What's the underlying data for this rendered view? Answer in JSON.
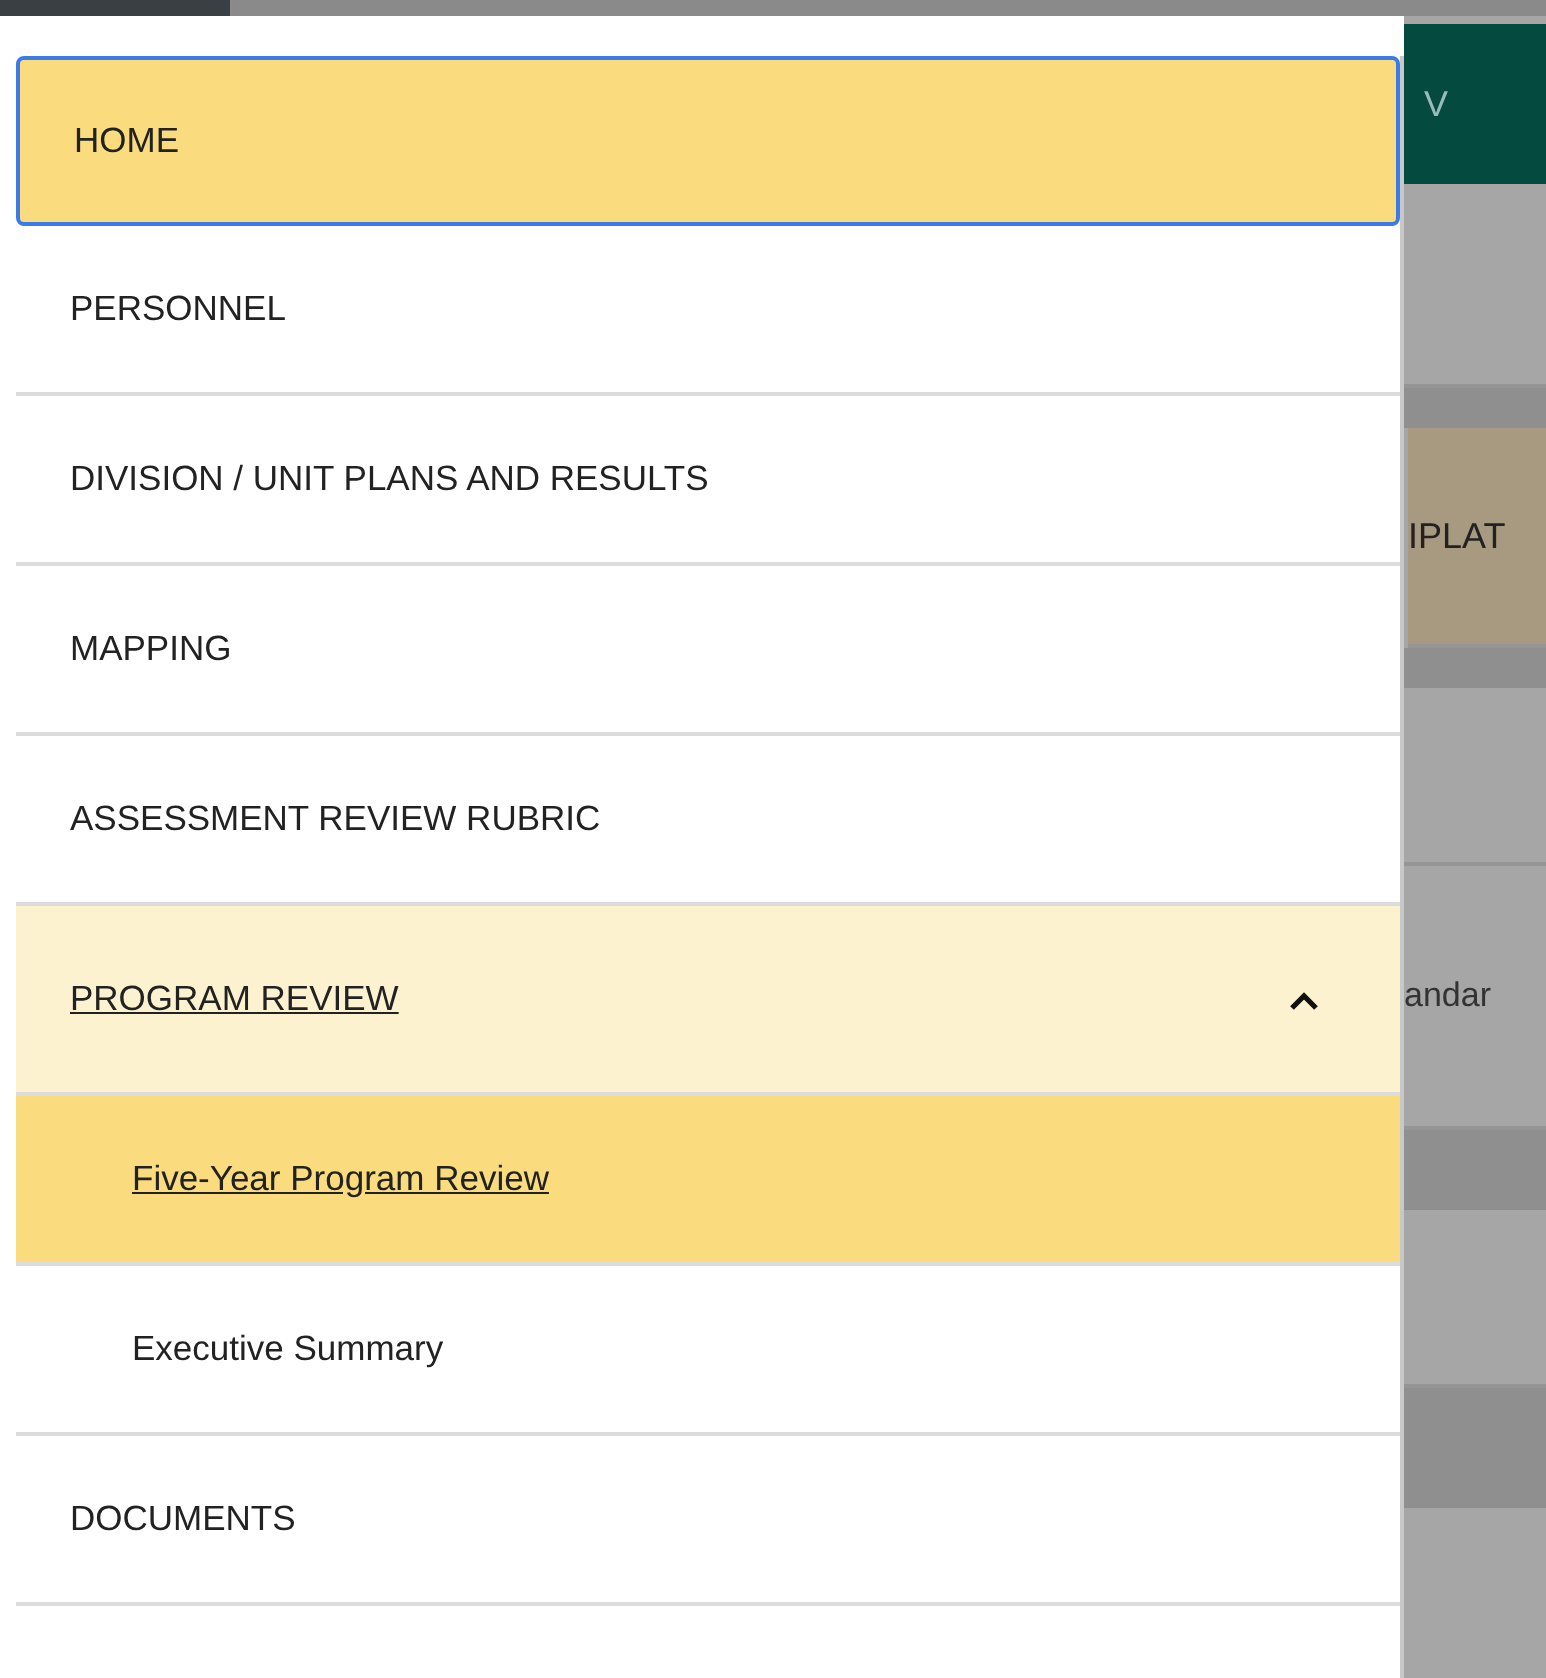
{
  "background": {
    "header_text": "V",
    "rows": [
      {
        "text": ""
      },
      {
        "text": "IPLAT"
      },
      {
        "text": "andar"
      }
    ]
  },
  "menu": {
    "items": [
      {
        "label": "HOME",
        "selected": true,
        "focused": true,
        "expanded": false
      },
      {
        "label": "PERSONNEL",
        "selected": false,
        "focused": false,
        "expanded": false
      },
      {
        "label": "DIVISION / UNIT PLANS AND RESULTS",
        "selected": false,
        "focused": false,
        "expanded": false
      },
      {
        "label": "MAPPING",
        "selected": false,
        "focused": false,
        "expanded": false
      },
      {
        "label": "ASSESSMENT REVIEW RUBRIC",
        "selected": false,
        "focused": false,
        "expanded": false
      },
      {
        "label": "PROGRAM REVIEW",
        "selected": false,
        "focused": false,
        "expanded": true,
        "children": [
          {
            "label": "Five-Year Program Review",
            "selected": true
          },
          {
            "label": "Executive Summary",
            "selected": false
          }
        ]
      },
      {
        "label": "DOCUMENTS",
        "selected": false,
        "focused": false,
        "expanded": false
      }
    ]
  }
}
